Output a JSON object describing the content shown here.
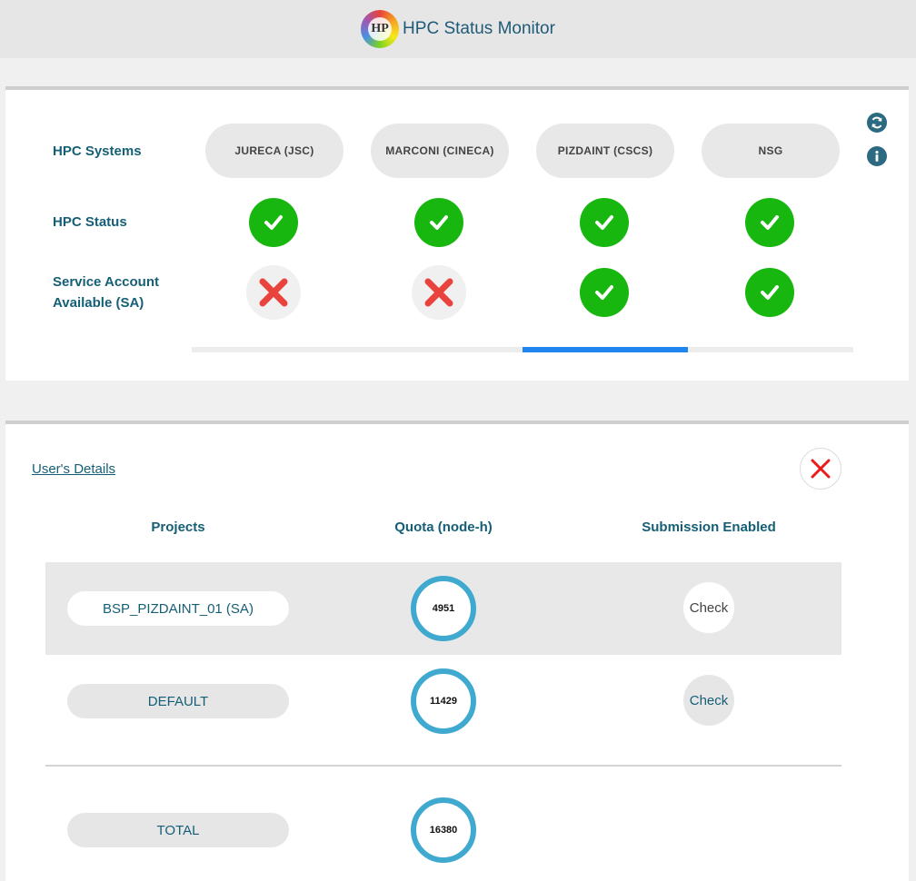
{
  "header": {
    "title": "HPC Status Monitor",
    "logo_text": "HP"
  },
  "systems": {
    "row_label": "HPC Systems",
    "items": [
      {
        "name": "JURECA (JSC)",
        "hpc_status": "ok",
        "service_account": "unavailable"
      },
      {
        "name": "MARCONI (CINECA)",
        "hpc_status": "ok",
        "service_account": "unavailable"
      },
      {
        "name": "PIZDAINT (CSCS)",
        "hpc_status": "ok",
        "service_account": "available"
      },
      {
        "name": "NSG",
        "hpc_status": "ok",
        "service_account": "available"
      }
    ],
    "selected_index": 2
  },
  "status_label": "HPC Status",
  "sa_label_line1": "Service Account",
  "sa_label_line2": "Available (SA)",
  "icons": {
    "refresh": "refresh-icon",
    "info": "info-icon",
    "check": "check-icon",
    "cross": "cross-icon",
    "close": "close-icon"
  },
  "details": {
    "link": "User's Details",
    "headers": {
      "projects": "Projects",
      "quota": "Quota (node-h)",
      "submission": "Submission Enabled"
    },
    "rows": [
      {
        "project": "BSP_PIZDAINT_01 (SA)",
        "quota": "4951",
        "check": "Check"
      },
      {
        "project": "DEFAULT",
        "quota": "11429",
        "check": "Check"
      }
    ],
    "total": {
      "label": "TOTAL",
      "quota": "16380"
    }
  },
  "colors": {
    "accent": "#155f76",
    "ok": "#17b70f",
    "error": "#e8433c",
    "quota_ring": "#3fa9cf",
    "active_tab": "#1f86f0"
  }
}
